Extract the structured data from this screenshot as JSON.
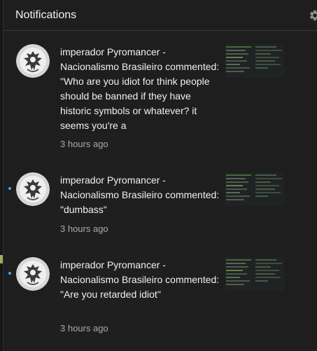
{
  "panel": {
    "title": "Notifications",
    "settings_icon": "gear-icon"
  },
  "notifications": [
    {
      "author": "imperador Pyromancer - Nacionalismo Brasileiro",
      "text": "imperador Pyromancer - Nacionalismo Brasileiro commented: \"Who are you idiot for think people should be banned if they have historic symbols or whatever? it seems you're a",
      "time": "3 hours ago",
      "unread": false
    },
    {
      "author": "imperador Pyromancer - Nacionalismo Brasileiro",
      "text": "imperador Pyromancer - Nacionalismo Brasileiro commented: \"dumbass\"",
      "time": "3 hours ago",
      "unread": true
    },
    {
      "author": "imperador Pyromancer - Nacionalismo Brasileiro",
      "text": "imperador Pyromancer - Nacionalismo Brasileiro commented: \"Are you retarded idiot\"",
      "time": "3 hours ago",
      "unread": true
    }
  ],
  "colors": {
    "panel_bg": "#202020",
    "text": "#f1f1f1",
    "secondary_text": "#aaaaaa",
    "unread_dot": "#3ea6ff"
  }
}
